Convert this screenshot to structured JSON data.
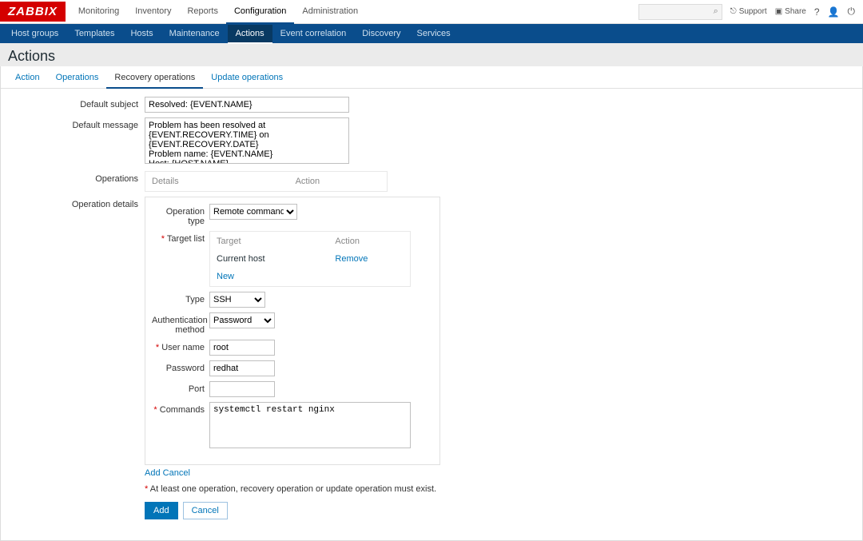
{
  "brand": "ZABBIX",
  "topnav": {
    "items": [
      "Monitoring",
      "Inventory",
      "Reports",
      "Configuration",
      "Administration"
    ],
    "active_index": 3
  },
  "top_right": {
    "support": "Support",
    "share": "Share",
    "help_icon": "?",
    "user_icon": "user",
    "power_icon": "power"
  },
  "subnav": {
    "items": [
      "Host groups",
      "Templates",
      "Hosts",
      "Maintenance",
      "Actions",
      "Event correlation",
      "Discovery",
      "Services"
    ],
    "active_index": 4
  },
  "page_title": "Actions",
  "tabs": {
    "items": [
      "Action",
      "Operations",
      "Recovery operations",
      "Update operations"
    ],
    "active_index": 2
  },
  "form": {
    "default_subject_label": "Default subject",
    "default_subject_value": "Resolved: {EVENT.NAME}",
    "default_message_label": "Default message",
    "default_message_value": "Problem has been resolved at {EVENT.RECOVERY.TIME} on {EVENT.RECOVERY.DATE}\nProblem name: {EVENT.NAME}\nHost: {HOST.NAME}\nSeverity: {EVENT.SEVERITY}\n\nOriginal problem ID: {EVENT.ID}",
    "operations_label": "Operations",
    "ops_table": {
      "col_details": "Details",
      "col_action": "Action"
    },
    "operation_details_label": "Operation details",
    "op": {
      "operation_type_label": "Operation type",
      "operation_type_value": "Remote command",
      "target_list_label": "Target list",
      "target_col_target": "Target",
      "target_col_action": "Action",
      "target_current_host": "Current host",
      "target_remove": "Remove",
      "target_new": "New",
      "type_label": "Type",
      "type_value": "SSH",
      "auth_method_label": "Authentication method",
      "auth_method_value": "Password",
      "username_label": "User name",
      "username_value": "root",
      "password_label": "Password",
      "password_value": "redhat",
      "port_label": "Port",
      "port_value": "",
      "commands_label": "Commands",
      "commands_value": "systemctl restart nginx"
    },
    "inline_add": "Add",
    "inline_cancel": "Cancel",
    "footnote": "At least one operation, recovery operation or update operation must exist.",
    "btn_add": "Add",
    "btn_cancel": "Cancel"
  }
}
